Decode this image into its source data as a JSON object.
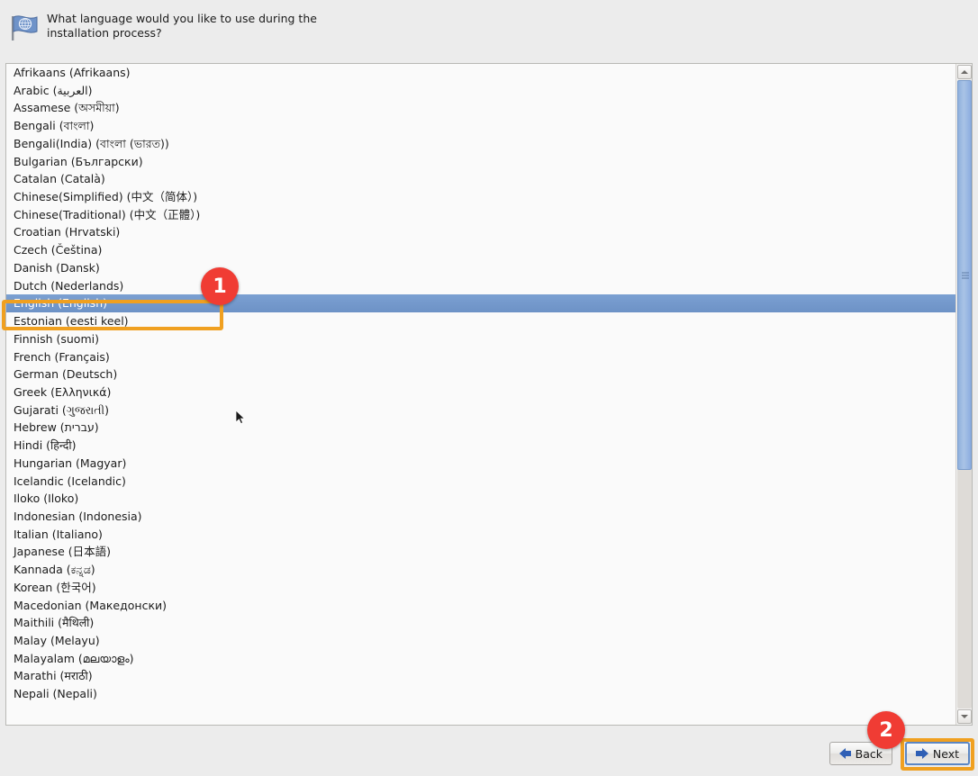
{
  "header": {
    "icon": "un-flag-icon",
    "prompt": "What language would you like to use during the installation process?"
  },
  "language_list": {
    "selected": "English (English)",
    "items": [
      "Afrikaans (Afrikaans)",
      "Arabic (العربية)",
      "Assamese (অসমীয়া)",
      "Bengali (বাংলা)",
      "Bengali(India) (বাংলা (ভারত))",
      "Bulgarian (Български)",
      "Catalan (Català)",
      "Chinese(Simplified) (中文（简体）)",
      "Chinese(Traditional) (中文（正體）)",
      "Croatian (Hrvatski)",
      "Czech (Čeština)",
      "Danish (Dansk)",
      "Dutch (Nederlands)",
      "English (English)",
      "Estonian (eesti keel)",
      "Finnish (suomi)",
      "French (Français)",
      "German (Deutsch)",
      "Greek (Ελληνικά)",
      "Gujarati (ગુજરાતી)",
      "Hebrew (עברית)",
      "Hindi (हिन्दी)",
      "Hungarian (Magyar)",
      "Icelandic (Icelandic)",
      "Iloko (Iloko)",
      "Indonesian (Indonesia)",
      "Italian (Italiano)",
      "Japanese (日本語)",
      "Kannada (ಕನ್ನಡ)",
      "Korean (한국어)",
      "Macedonian (Македонски)",
      "Maithili (मैथिली)",
      "Malay (Melayu)",
      "Malayalam (മലയാളം)",
      "Marathi (मराठी)",
      "Nepali (Nepali)"
    ]
  },
  "scrollbar": {
    "up_arrow": "scroll-up-icon",
    "down_arrow": "scroll-down-icon",
    "thumb_position_percent": 0,
    "thumb_size_percent": 62
  },
  "buttons": {
    "back": "Back",
    "next": "Next"
  },
  "annotations": [
    {
      "number": "1",
      "target": "english-language-row"
    },
    {
      "number": "2",
      "target": "next-button"
    }
  ],
  "colors": {
    "window_background": "#ececec",
    "list_background": "#fafafa",
    "selection_blue": "#6d92c6",
    "annotation_orange": "#f0a020",
    "badge_red": "#f03c34",
    "arrow_blue": "#2f5fb5"
  }
}
